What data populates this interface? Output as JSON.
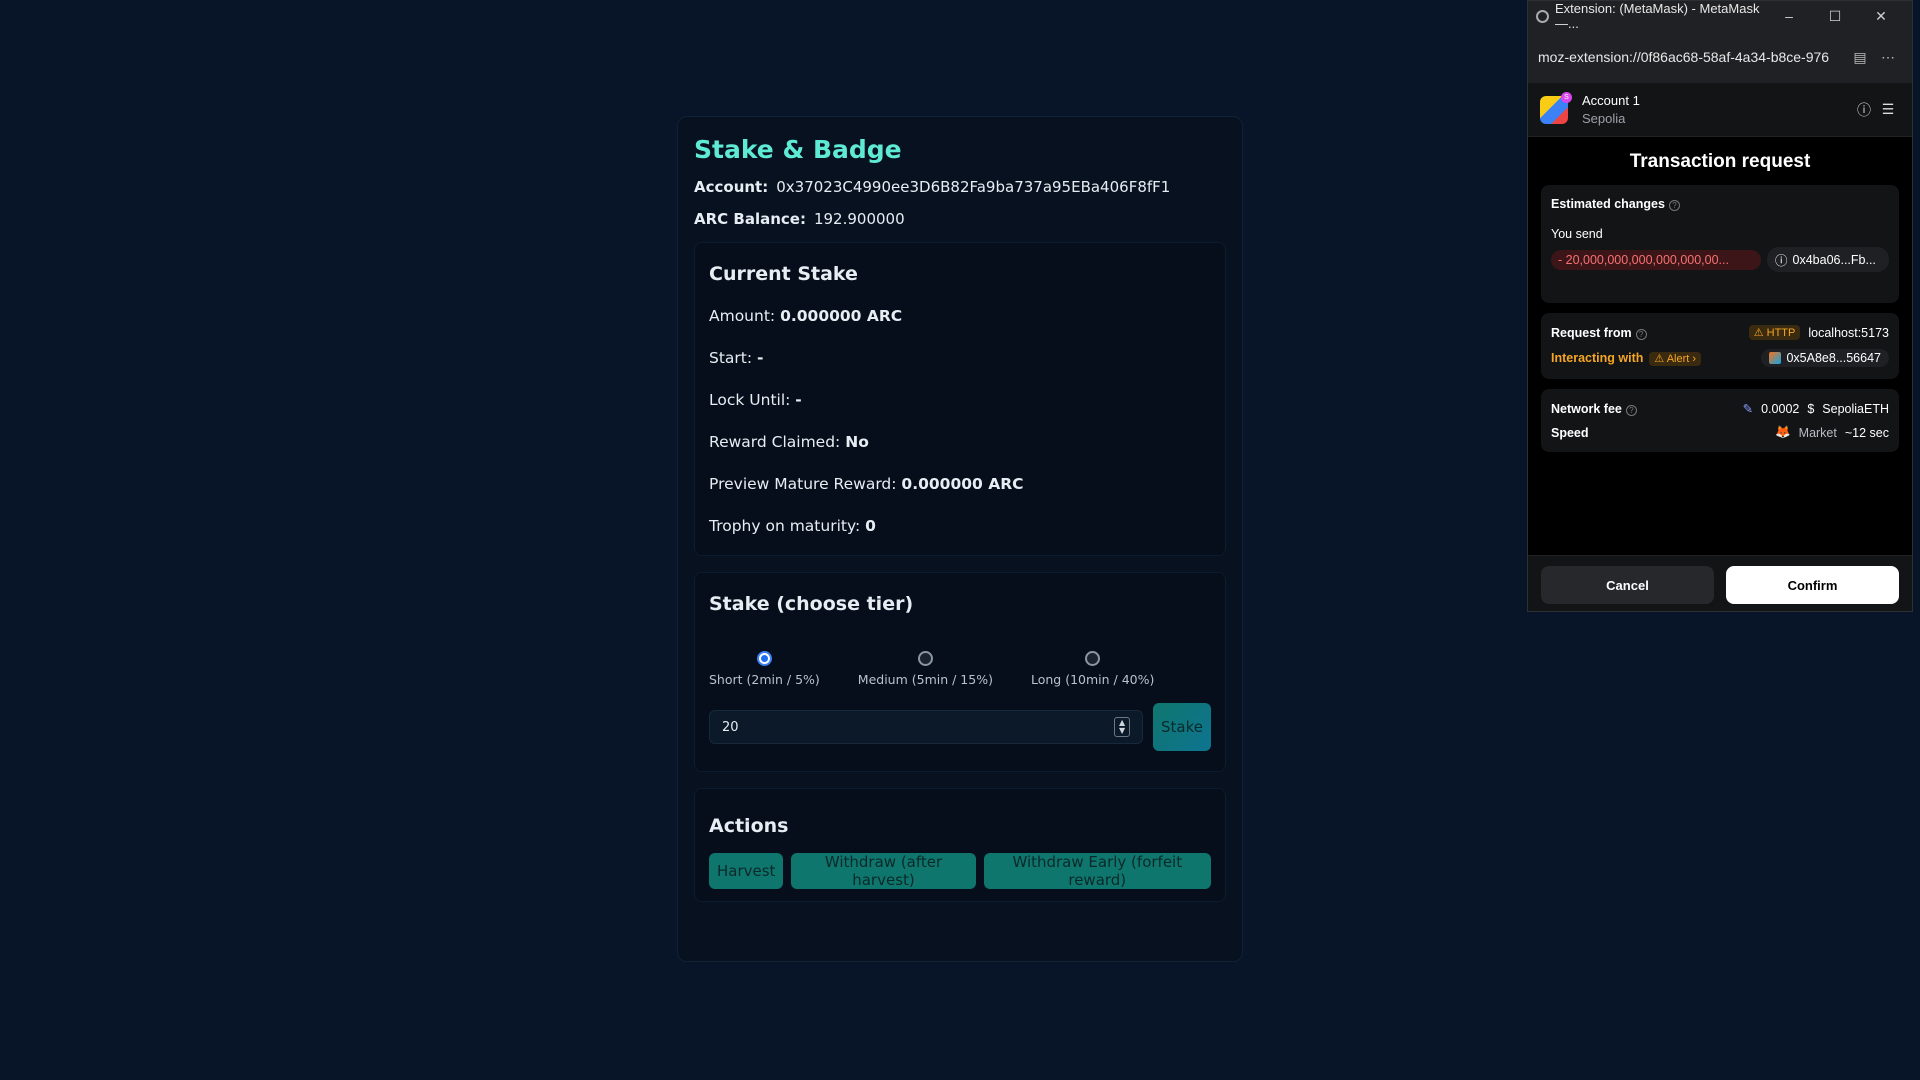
{
  "app": {
    "title": "Stake & Badge",
    "account_label": "Account:",
    "account_value": "0x37023C4990ee3D6B82Fa9ba737a95EBa406F8fF1",
    "balance_label": "ARC Balance:",
    "balance_value": "192.900000"
  },
  "current_stake": {
    "heading": "Current Stake",
    "amount_label": "Amount:",
    "amount_value": "0.000000 ARC",
    "start_label": "Start:",
    "start_value": "-",
    "lock_label": "Lock Until:",
    "lock_value": "-",
    "claimed_label": "Reward Claimed:",
    "claimed_value": "No",
    "preview_label": "Preview Mature Reward:",
    "preview_value": "0.000000 ARC",
    "trophy_label": "Trophy on maturity:",
    "trophy_value": "0"
  },
  "stake_form": {
    "heading": "Stake (choose tier)",
    "tiers": [
      {
        "label": "Short (2min / 5%)",
        "selected": true
      },
      {
        "label": "Medium (5min / 15%)",
        "selected": false
      },
      {
        "label": "Long (10min / 40%)",
        "selected": false
      }
    ],
    "amount_value": "20",
    "stake_button": "Stake"
  },
  "actions": {
    "heading": "Actions",
    "harvest": "Harvest",
    "withdraw": "Withdraw (after harvest)",
    "withdraw_early": "Withdraw Early (forfeit reward)"
  },
  "metamask": {
    "window_title": "Extension: (MetaMask) - MetaMask —...",
    "url": "moz-extension://0f86ac68-58af-4a34-b8ce-976",
    "account_name": "Account 1",
    "network": "Sepolia",
    "heading": "Transaction request",
    "estimated_changes": "Estimated changes",
    "you_send": "You send",
    "send_amount": "- 20,000,000,000,000,000,00...",
    "send_to": "0x4ba06...Fb...",
    "request_from_label": "Request from",
    "http_tag": "HTTP",
    "request_from_value": "localhost:5173",
    "interacting_label": "Interacting with",
    "alert_tag": "Alert",
    "interacting_value": "0x5A8e8...56647",
    "fee_label": "Network fee",
    "fee_value": "0.0002",
    "fee_unit": "SepoliaETH",
    "speed_label": "Speed",
    "speed_mode": "Market",
    "speed_value": "~12 sec",
    "cancel": "Cancel",
    "confirm": "Confirm"
  }
}
